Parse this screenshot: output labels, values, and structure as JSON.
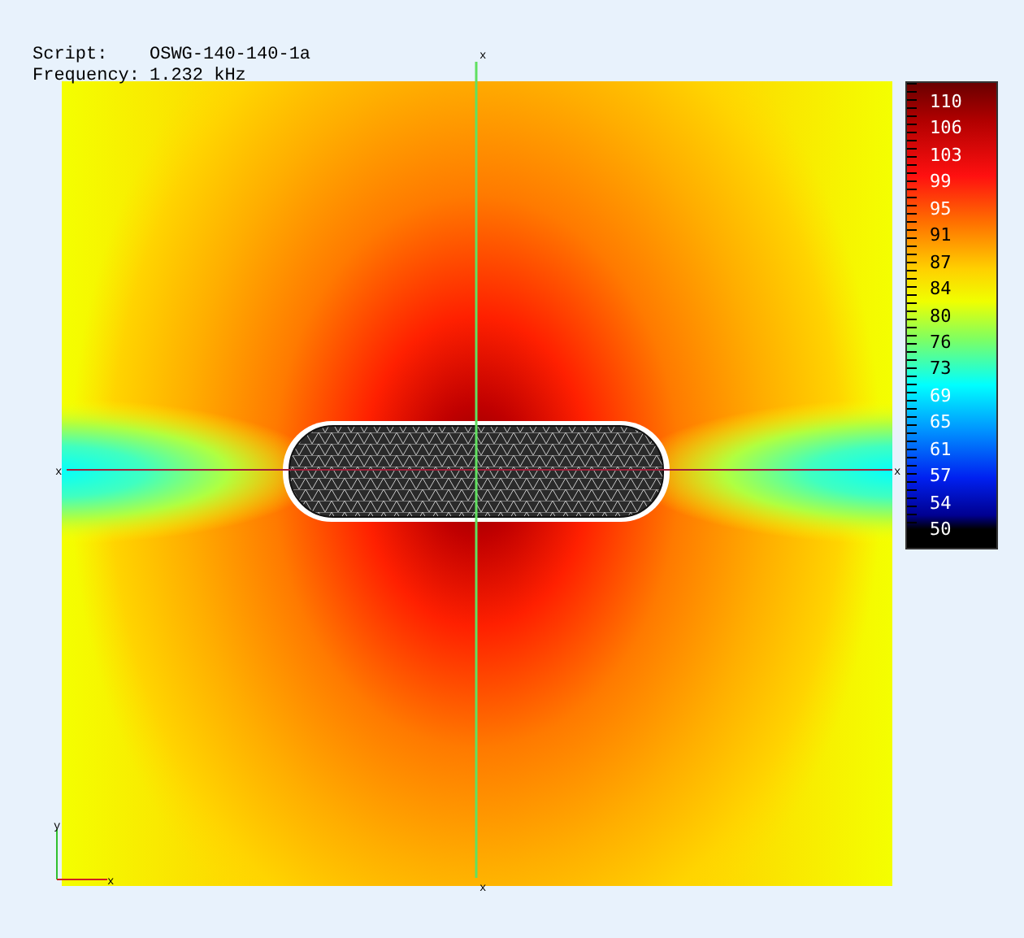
{
  "header": {
    "script_label": "Script:",
    "script_value": "OSWG-140-140-1a",
    "frequency_label": "Frequency:",
    "frequency_value": "1.232 kHz"
  },
  "plot": {
    "axis_markers": [
      "x",
      "x",
      "x",
      "x"
    ],
    "triad": {
      "x_label": "x",
      "y_label": "y"
    }
  },
  "legend": {
    "labels": [
      "110",
      "106",
      "103",
      "99",
      "95",
      "91",
      "87",
      "84",
      "80",
      "76",
      "73",
      "69",
      "65",
      "61",
      "57",
      "54",
      "50"
    ]
  }
}
